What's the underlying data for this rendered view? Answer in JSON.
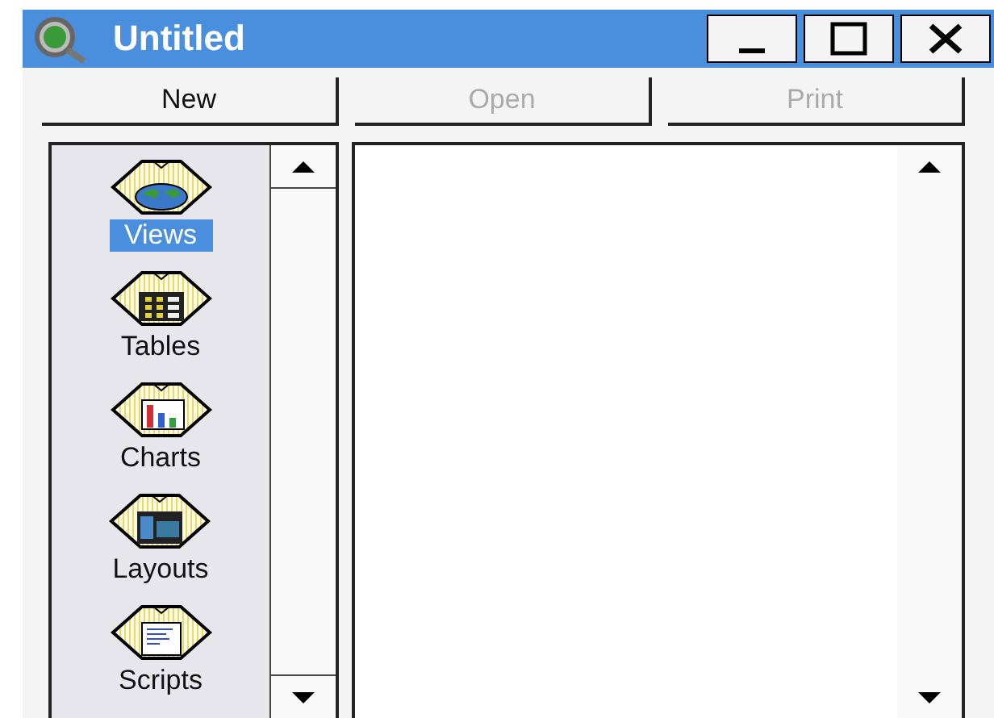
{
  "window": {
    "title": "Untitled"
  },
  "buttons": [
    {
      "label": "New",
      "disabled": false
    },
    {
      "label": "Open",
      "disabled": true
    },
    {
      "label": "Print",
      "disabled": true
    }
  ],
  "sidebar": {
    "items": [
      {
        "label": "Views",
        "kind": "views",
        "selected": true
      },
      {
        "label": "Tables",
        "kind": "tables",
        "selected": false
      },
      {
        "label": "Charts",
        "kind": "charts",
        "selected": false
      },
      {
        "label": "Layouts",
        "kind": "layouts",
        "selected": false
      },
      {
        "label": "Scripts",
        "kind": "scripts",
        "selected": false
      }
    ]
  }
}
